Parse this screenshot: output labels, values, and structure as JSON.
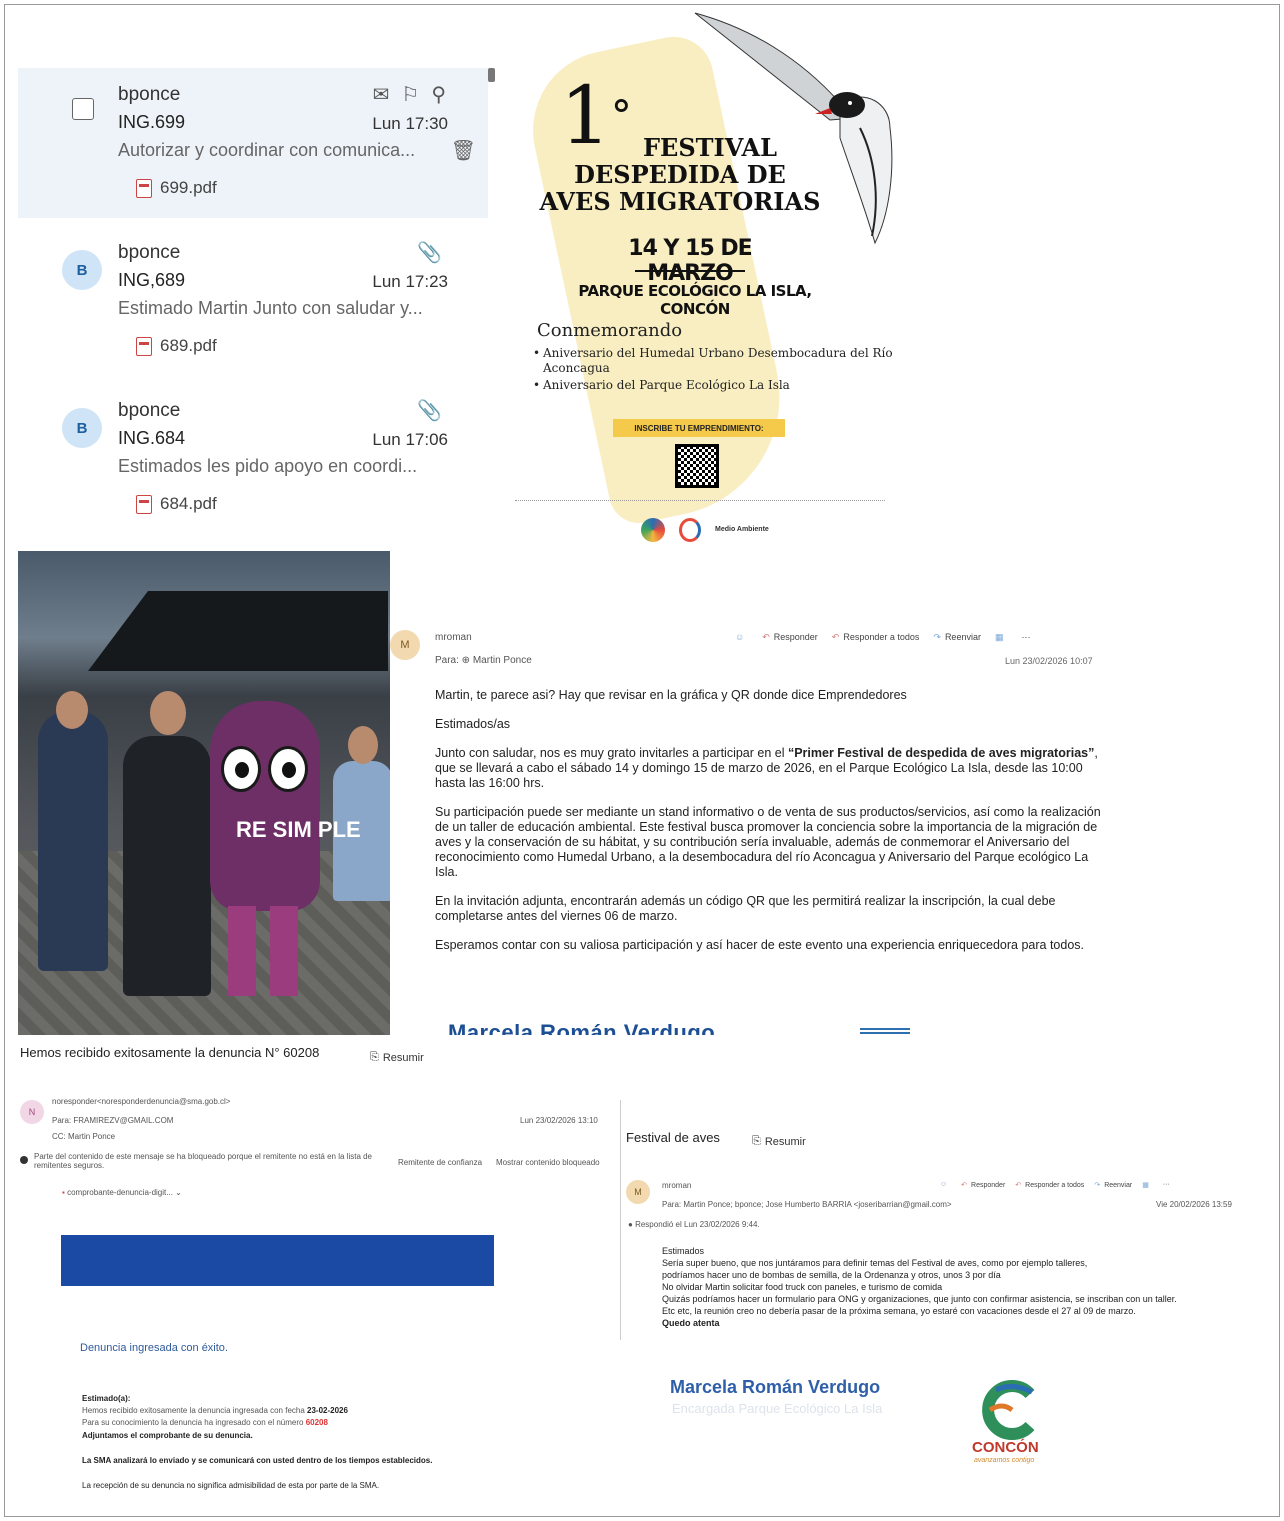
{
  "mail_list": {
    "items": [
      {
        "sender": "bponce",
        "subject": "ING.699",
        "time": "Lun 17:30",
        "preview": "Autorizar y coordinar con comunica...",
        "attachment": "699.pdf"
      },
      {
        "sender": "bponce",
        "subject": "ING,689",
        "time": "Lun 17:23",
        "preview": "Estimado Martin Junto con saludar y...",
        "attachment": "689.pdf",
        "avatar": "B"
      },
      {
        "sender": "bponce",
        "subject": "ING.684",
        "time": "Lun 17:06",
        "preview": "Estimados les pido apoyo en coordi...",
        "attachment": "684.pdf",
        "avatar": "B"
      }
    ]
  },
  "poster": {
    "number": "1",
    "degree": "°",
    "title_line1": "FESTIVAL",
    "title_line2": "DESPEDIDA DE",
    "title_line3": "AVES MIGRATORIAS",
    "dates": "14 Y 15 DE MARZO",
    "place": "PARQUE ECOLÓGICO LA ISLA, CONCÓN",
    "commemorating": "Conmemorando",
    "bullet1": "Aniversario del Humedal Urbano Desembocadura del Río Aconcagua",
    "bullet2": "Aniversario del Parque Ecológico La Isla",
    "inscribe": "INSCRIBE TU EMPRENDIMIENTO:",
    "logo_text": "Medio Ambiente"
  },
  "email1": {
    "avatar": "M",
    "from": "mroman",
    "to_label": "Para:",
    "to": "Martin Ponce",
    "actions": {
      "reply": "Responder",
      "reply_all": "Responder a todos",
      "forward": "Reenviar"
    },
    "date": "Lun 23/02/2026 10:07",
    "intro": "Martin, te parece asi? Hay que revisar en la gráfica y QR donde dice Emprendedores",
    "greeting": "Estimados/as",
    "p1_a": "Junto con saludar, nos es muy grato invitarles a participar en el ",
    "p1_b": "“Primer Festival de despedida de aves migratorias”",
    "p1_c": ", que se llevará a cabo el sábado 14 y domingo 15 de marzo de 2026, en el Parque Ecológico La Isla, desde las 10:00 hasta las 16:00 hrs.",
    "p2": "Su participación puede ser mediante un stand informativo o de venta de sus productos/servicios, así como la realización de un taller de educación ambiental. Este festival busca promover la conciencia sobre la importancia de la migración de aves y la conservación de su hábitat, y su contribución sería invaluable, además de conmemorar el Aniversario del reconocimiento como Humedal Urbano, a la desembocadura del río Aconcagua y Aniversario del Parque ecológico La Isla.",
    "p3": "En la invitación adjunta, encontrarán además un código QR que les permitirá realizar la inscripción, la cual debe completarse antes del viernes 06 de marzo.",
    "p4": "Esperamos contar con su valiosa participación y así hacer de este evento una experiencia enriquecedora para todos.",
    "signature_cut": "Marcela Román Verdugo"
  },
  "photo": {
    "mascot_text": "RE SIM PLE"
  },
  "denuncia": {
    "title": "Hemos recibido exitosamente la denuncia N° 60208",
    "resumir": "Resumir",
    "avatar": "N",
    "from": "noresponder<noresponderdenuncia@sma.gob.cl>",
    "to": "Para: FRAMIREZV@GMAIL.COM",
    "cc": "CC: Martin Ponce",
    "date": "Lun 23/02/2026 13:10",
    "blocked": "Parte del contenido de este mensaje se ha bloqueado porque el remitente no está en la lista de remitentes seguros.",
    "trusted": "Remitente de confianza",
    "show_blocked": "Mostrar contenido bloqueado",
    "attachment": "comprobante-denuncia-digit...",
    "ok": "Denuncia ingresada con éxito.",
    "greeting": "Estimado(a):",
    "l1_a": "Hemos recibido exitosamente la denuncia ingresada con fecha ",
    "l1_b": "23-02-2026",
    "l2_a": "Para su conocimiento la denuncia ha ingresado con el número ",
    "l2_b": "60208",
    "l3": "Adjuntamos el comprobante de su denuncia.",
    "l4": "La SMA analizará lo enviado y se comunicará con usted dentro de los tiempos establecidos.",
    "l5": "La recepción de su denuncia no significa admisibilidad de esta por parte de la SMA."
  },
  "festival_email": {
    "title": "Festival de aves",
    "resumir": "Resumir",
    "avatar": "M",
    "from": "mroman",
    "actions": {
      "reply": "Responder",
      "reply_all": "Responder a todos",
      "forward": "Reenviar"
    },
    "to": "Para: Martin Ponce; bponce; Jose Humberto BARRIA <joseribarrian@gmail.com>",
    "date": "Vie 20/02/2026 13:59",
    "replied": "Respondió el Lun 23/02/2026 9:44.",
    "l1": "Estimados",
    "l2": "Sería super bueno, que nos juntáramos para definir temas del Festival de aves, como por ejemplo talleres,",
    "l3": "podríamos hacer uno de bombas de semilla, de la Ordenanza y otros, unos 3 por día",
    "l4": "No olvidar Martin solicitar food truck con paneles, e turismo de comida",
    "l5": "Quizás podríamos hacer un formulario para ONG y organizaciones, que junto con confirmar asistencia, se inscriban con un taller.",
    "l6": "Etc etc, la reunión creo no debería pasar de la próxima semana, yo estaré con vacaciones desde el 27 al 09 de marzo.",
    "l7": "Quedo atenta",
    "sig_name": "Marcela Román Verdugo",
    "sig_role": "Encargada Parque Ecológico La Isla",
    "concon": "CONCÓN",
    "concon_tag": "avanzamos contigo"
  }
}
